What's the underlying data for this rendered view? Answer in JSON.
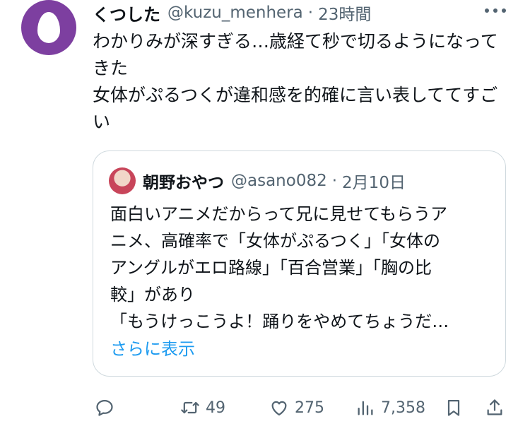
{
  "author": {
    "name": "くつした",
    "handle": "@kuzu_menhera",
    "separator": "·",
    "time": "23時間"
  },
  "tweet": {
    "text": "わかりみが深すぎる…歳経て秒で切るようになってきた\n女体がぷるつくが違和感を的確に言い表しててすごい"
  },
  "quote": {
    "name": "朝野おやつ",
    "handle": "@asano082",
    "separator": "·",
    "time": "2月10日",
    "lines": [
      "面白いアニメだからって兄に見せてもらうア",
      "ニメ、高確率で「女体がぷるつく」「女体の",
      "アングルがエロ路線」「百合営業」「胸の比",
      "較」があり",
      "「もうけっこうよ！踊りをやめてちょうだ…"
    ],
    "show_more": "さらに表示"
  },
  "actions": {
    "reply": {
      "icon": "reply-icon"
    },
    "retweet": {
      "icon": "retweet-icon",
      "count": "49"
    },
    "like": {
      "icon": "heart-icon",
      "count": "275"
    },
    "views": {
      "icon": "views-icon",
      "count": "7,358"
    },
    "bookmark": {
      "icon": "bookmark-icon"
    },
    "share": {
      "icon": "share-icon"
    }
  },
  "colors": {
    "avatar_bg": "#7d3fa0",
    "text": "#0f1419",
    "secondary": "#536471",
    "link": "#1d9bf0",
    "border": "#cfd9de"
  }
}
